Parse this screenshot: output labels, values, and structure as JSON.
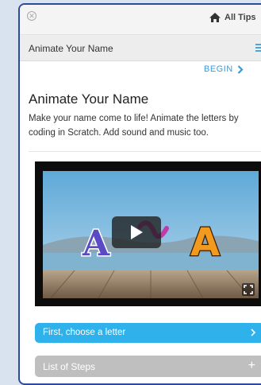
{
  "header": {
    "all_tips_label": "All Tips"
  },
  "titlebar": {
    "title": "Animate Your Name"
  },
  "begin": {
    "label": "BEGIN"
  },
  "intro": {
    "heading": "Animate Your Name",
    "description": "Make your name come to life! Animate the letters by coding in Scratch. Add sound and music too."
  },
  "video": {
    "letters": [
      "A",
      "A"
    ]
  },
  "steps": {
    "first_step_label": "First, choose a letter",
    "list_label": "List of Steps"
  },
  "colors": {
    "accent": "#2fb1eb",
    "frame": "#2e4a9e",
    "list_button": "#bfbfbf"
  },
  "icons": [
    "close-icon",
    "home-icon",
    "menu-icon",
    "chevron-right-icon",
    "play-icon",
    "fullscreen-icon",
    "plus-icon"
  ]
}
